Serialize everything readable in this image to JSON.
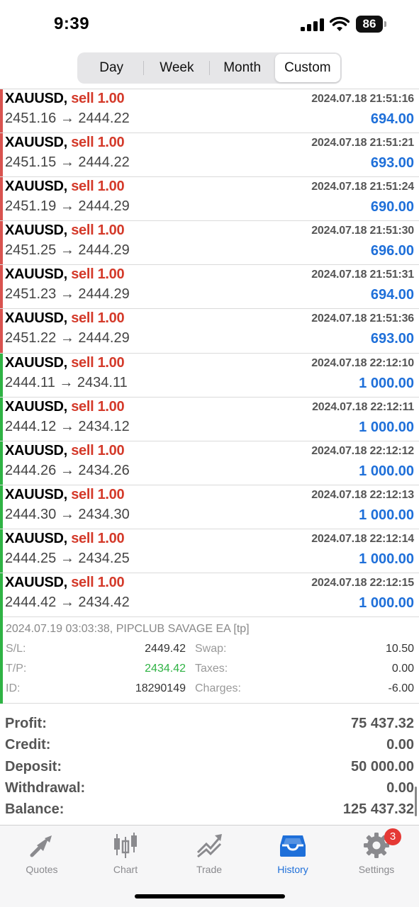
{
  "status_bar": {
    "time": "9:39",
    "battery": "86"
  },
  "period_tabs": [
    {
      "label": "Day",
      "active": false
    },
    {
      "label": "Week",
      "active": false
    },
    {
      "label": "Month",
      "active": false
    },
    {
      "label": "Custom",
      "active": true
    }
  ],
  "deals": [
    {
      "symbol": "XAUUSD,",
      "side": "sell 1.00",
      "prices": "2451.16 → 2444.22",
      "time": "2024.07.18 21:51:16",
      "profit": "694.00",
      "bar_color": "#d9534f"
    },
    {
      "symbol": "XAUUSD,",
      "side": "sell 1.00",
      "prices": "2451.15 → 2444.22",
      "time": "2024.07.18 21:51:21",
      "profit": "693.00",
      "bar_color": "#d9534f"
    },
    {
      "symbol": "XAUUSD,",
      "side": "sell 1.00",
      "prices": "2451.19 → 2444.29",
      "time": "2024.07.18 21:51:24",
      "profit": "690.00",
      "bar_color": "#d9534f"
    },
    {
      "symbol": "XAUUSD,",
      "side": "sell 1.00",
      "prices": "2451.25 → 2444.29",
      "time": "2024.07.18 21:51:30",
      "profit": "696.00",
      "bar_color": "#d9534f"
    },
    {
      "symbol": "XAUUSD,",
      "side": "sell 1.00",
      "prices": "2451.23 → 2444.29",
      "time": "2024.07.18 21:51:31",
      "profit": "694.00",
      "bar_color": "#d9534f"
    },
    {
      "symbol": "XAUUSD,",
      "side": "sell 1.00",
      "prices": "2451.22 → 2444.29",
      "time": "2024.07.18 21:51:36",
      "profit": "693.00",
      "bar_color": "#d9534f"
    },
    {
      "symbol": "XAUUSD,",
      "side": "sell 1.00",
      "prices": "2444.11 → 2434.11",
      "time": "2024.07.18 22:12:10",
      "profit": "1 000.00",
      "bar_color": "#2fb344"
    },
    {
      "symbol": "XAUUSD,",
      "side": "sell 1.00",
      "prices": "2444.12 → 2434.12",
      "time": "2024.07.18 22:12:11",
      "profit": "1 000.00",
      "bar_color": "#2fb344"
    },
    {
      "symbol": "XAUUSD,",
      "side": "sell 1.00",
      "prices": "2444.26 → 2434.26",
      "time": "2024.07.18 22:12:12",
      "profit": "1 000.00",
      "bar_color": "#2fb344"
    },
    {
      "symbol": "XAUUSD,",
      "side": "sell 1.00",
      "prices": "2444.30 → 2434.30",
      "time": "2024.07.18 22:12:13",
      "profit": "1 000.00",
      "bar_color": "#2fb344"
    },
    {
      "symbol": "XAUUSD,",
      "side": "sell 1.00",
      "prices": "2444.25 → 2434.25",
      "time": "2024.07.18 22:12:14",
      "profit": "1 000.00",
      "bar_color": "#2fb344"
    },
    {
      "symbol": "XAUUSD,",
      "side": "sell 1.00",
      "prices": "2444.42 → 2434.42",
      "time": "2024.07.18 22:12:15",
      "profit": "1 000.00",
      "bar_color": "#2fb344"
    }
  ],
  "details": {
    "comment": "2024.07.19 03:03:38, PIPCLUB SAVAGE EA [tp]",
    "sl_label": "S/L:",
    "sl_value": "2449.42",
    "tp_label": "T/P:",
    "tp_value": "2434.42",
    "id_label": "ID:",
    "id_value": "18290149",
    "swap_label": "Swap:",
    "swap_value": "10.50",
    "taxes_label": "Taxes:",
    "taxes_value": "0.00",
    "charges_label": "Charges:",
    "charges_value": "-6.00",
    "tp_color": "#2fb344"
  },
  "summary": [
    {
      "label": "Profit:",
      "value": "75 437.32"
    },
    {
      "label": "Credit:",
      "value": "0.00"
    },
    {
      "label": "Deposit:",
      "value": "50 000.00"
    },
    {
      "label": "Withdrawal:",
      "value": "0.00"
    },
    {
      "label": "Balance:",
      "value": "125 437.32"
    }
  ],
  "tabbar": [
    {
      "label": "Quotes",
      "icon": "quotes-icon",
      "active": false
    },
    {
      "label": "Chart",
      "icon": "chart-icon",
      "active": false
    },
    {
      "label": "Trade",
      "icon": "trade-icon",
      "active": false
    },
    {
      "label": "History",
      "icon": "history-icon",
      "active": true
    },
    {
      "label": "Settings",
      "icon": "settings-icon",
      "active": false,
      "badge": "3"
    }
  ],
  "colors": {
    "accent": "#1e6fd9",
    "sell": "#d43a2a",
    "loss_bar": "#d9534f",
    "win_bar": "#2fb344"
  }
}
